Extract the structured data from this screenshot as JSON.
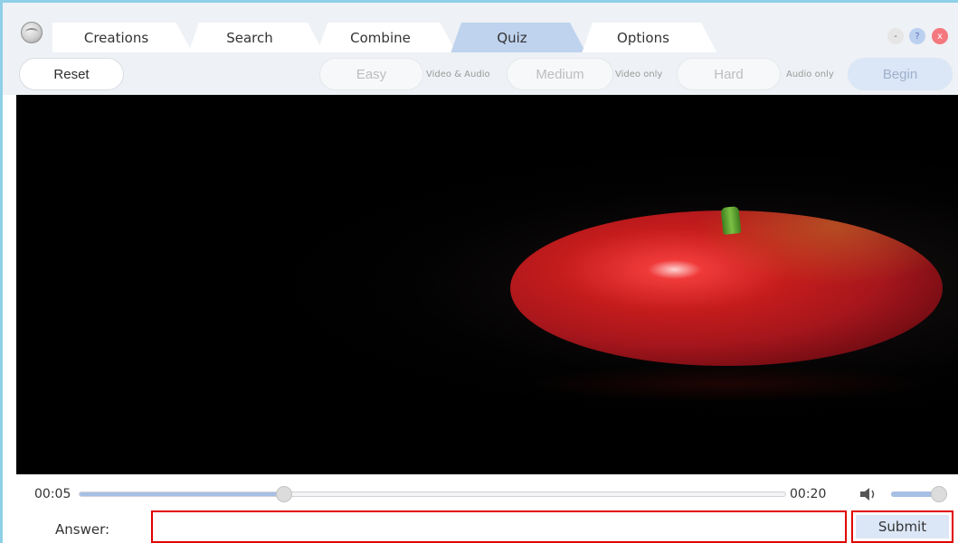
{
  "tabs": [
    {
      "label": "Creations",
      "active": false
    },
    {
      "label": "Search",
      "active": false
    },
    {
      "label": "Combine",
      "active": false
    },
    {
      "label": "Quiz",
      "active": true
    },
    {
      "label": "Options",
      "active": false
    }
  ],
  "window_controls": {
    "minimize": "-",
    "help": "?",
    "close": "x"
  },
  "toolbar": {
    "reset": "Reset",
    "easy": "Easy",
    "easy_hint": "Video & Audio",
    "medium": "Medium",
    "medium_hint": "Video only",
    "hard": "Hard",
    "hard_hint": "Audio only",
    "begin": "Begin"
  },
  "player": {
    "current_time": "00:05",
    "total_time": "00:20",
    "progress_fraction": 0.29,
    "volume_fraction": 1.0
  },
  "answer": {
    "label": "Answer:",
    "value": "",
    "placeholder": "",
    "submit": "Submit"
  },
  "colors": {
    "accent": "#bfd3ee",
    "highlight_border": "#e00000",
    "close": "#f4787e"
  }
}
